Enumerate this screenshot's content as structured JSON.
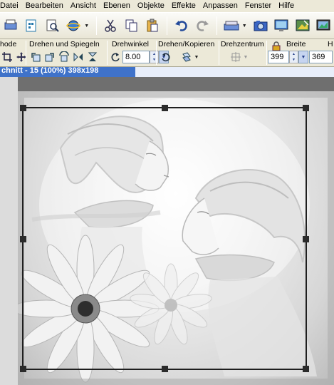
{
  "menu": [
    "Datei",
    "Bearbeiten",
    "Ansicht",
    "Ebenen",
    "Objekte",
    "Effekte",
    "Anpassen",
    "Fenster",
    "Hilfe"
  ],
  "toolbar_buttons": [
    {
      "name": "scan-icon"
    },
    {
      "name": "new-icon"
    },
    {
      "name": "zoom-icon"
    },
    {
      "name": "browser-icon"
    },
    {
      "name": "cut-icon"
    },
    {
      "name": "copy-icon"
    },
    {
      "name": "paste-icon"
    },
    {
      "name": "undo-icon"
    },
    {
      "name": "redo-icon"
    },
    {
      "name": "scanner-icon"
    },
    {
      "name": "camera-icon"
    },
    {
      "name": "screen-capture-icon"
    },
    {
      "name": "enhance-icon"
    },
    {
      "name": "display-icon"
    }
  ],
  "options": {
    "method_label": "hode",
    "rotate_mirror_label": "Drehen und Spiegeln",
    "angle_label": "Drehwinkel",
    "angle_value": "8.00",
    "rotate_copy_label": "Drehen/Kopieren",
    "center_label": "Drehzentrum",
    "width_label": "Breite",
    "width_value": "399",
    "height_label": "H",
    "height_value": "369"
  },
  "document": {
    "title": "chnitt - 15 (100%) 398x198"
  },
  "colors": {
    "accent": "#3f72c9",
    "menubar": "#ece9d8",
    "canvas_gray": "#bcbcbc"
  }
}
